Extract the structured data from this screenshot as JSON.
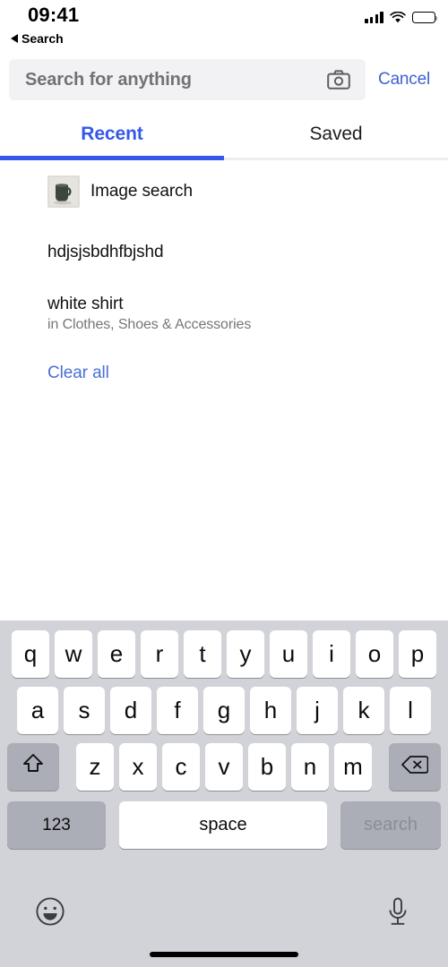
{
  "status_bar": {
    "time": "09:41",
    "signal_icon": "cellular-signal-icon",
    "wifi_icon": "wifi-icon",
    "battery_icon": "battery-icon"
  },
  "back_indicator": {
    "arrow_icon": "back-triangle-icon",
    "label": "Search"
  },
  "search": {
    "placeholder": "Search for anything",
    "value": "",
    "camera_icon": "camera-icon",
    "cancel_label": "Cancel"
  },
  "tabs": {
    "items": [
      {
        "label": "Recent",
        "active": true
      },
      {
        "label": "Saved",
        "active": false
      }
    ],
    "active_color": "#3558e9"
  },
  "recent": {
    "items": [
      {
        "type": "image",
        "label": "Image search",
        "thumb_icon": "mug-thumbnail"
      },
      {
        "type": "text",
        "title": "hdjsjsbdhfbjshd",
        "subtitle": ""
      },
      {
        "type": "text",
        "title": "white shirt",
        "subtitle": "in Clothes, Shoes & Accessories"
      }
    ],
    "clear_all_label": "Clear all",
    "link_color": "#4a6fd4"
  },
  "keyboard": {
    "row1": [
      "q",
      "w",
      "e",
      "r",
      "t",
      "y",
      "u",
      "i",
      "o",
      "p"
    ],
    "row2": [
      "a",
      "s",
      "d",
      "f",
      "g",
      "h",
      "j",
      "k",
      "l"
    ],
    "row3": [
      "z",
      "x",
      "c",
      "v",
      "b",
      "n",
      "m"
    ],
    "shift_icon": "shift-arrow-icon",
    "delete_icon": "backspace-icon",
    "numeric_label": "123",
    "space_label": "space",
    "return_label": "search",
    "emoji_icon": "emoji-smiley-icon",
    "mic_icon": "microphone-icon"
  }
}
